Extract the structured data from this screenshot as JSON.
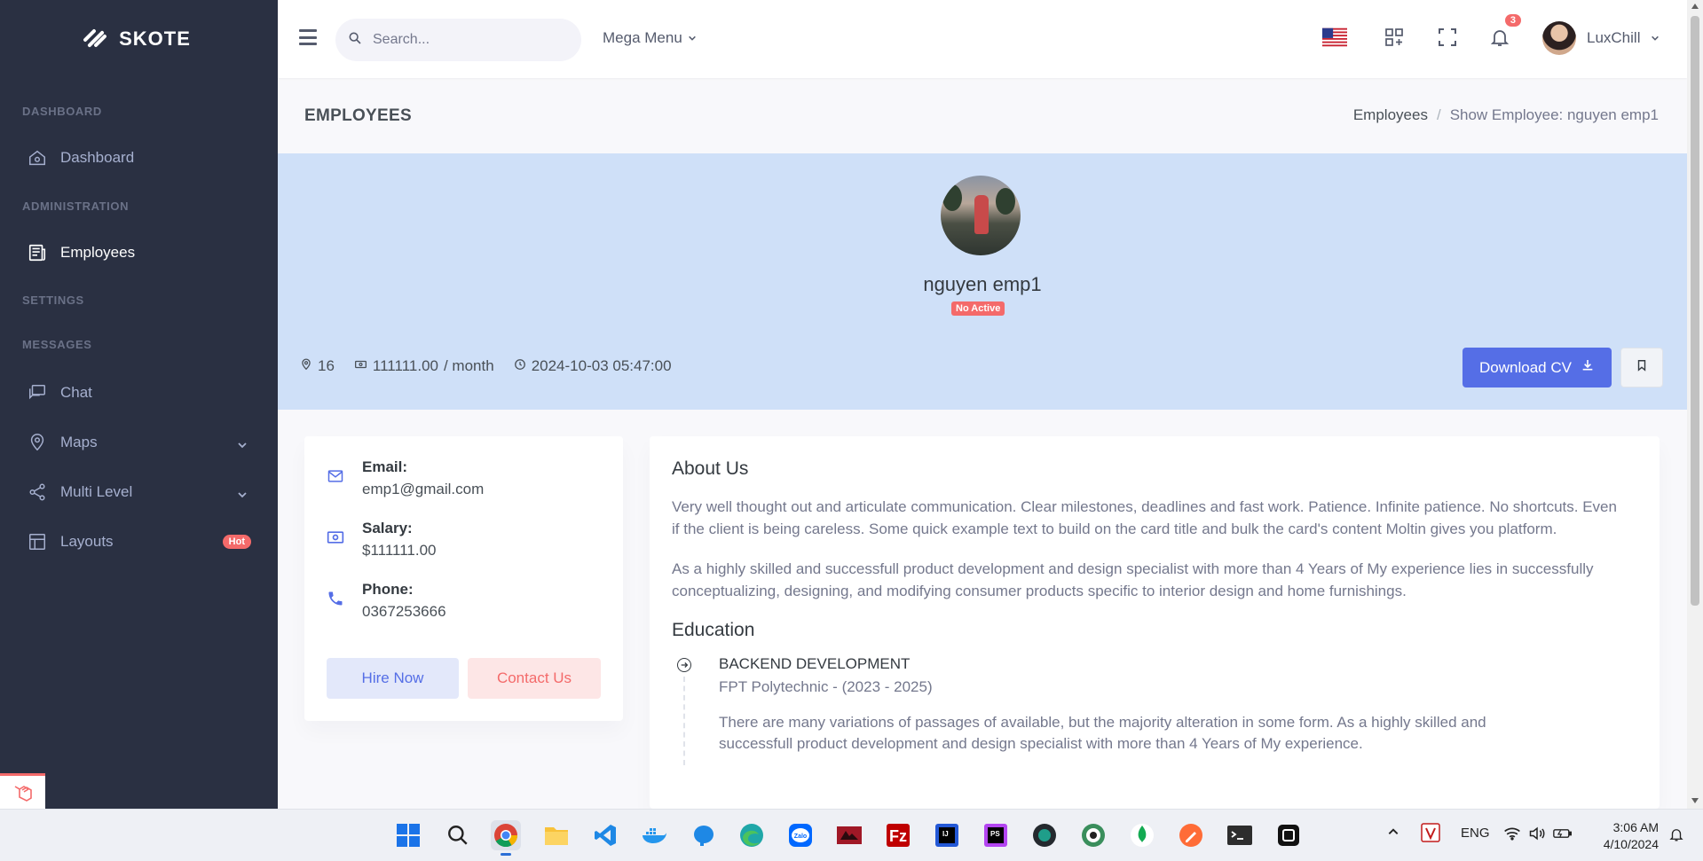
{
  "brand": {
    "name": "SKOTE"
  },
  "sidebar": {
    "sections": [
      {
        "title": "DASHBOARD"
      },
      {
        "title": "ADMINISTRATION"
      },
      {
        "title": "SETTINGS"
      },
      {
        "title": "MESSAGES"
      }
    ],
    "items": [
      {
        "label": "Dashboard",
        "icon": "home-icon"
      },
      {
        "label": "Employees",
        "icon": "newspaper-icon",
        "active": true
      },
      {
        "label": "Chat",
        "icon": "chat-icon"
      },
      {
        "label": "Maps",
        "icon": "map-pin-icon"
      },
      {
        "label": "Multi Level",
        "icon": "share-icon"
      },
      {
        "label": "Layouts",
        "icon": "layout-icon",
        "badge": "Hot"
      }
    ]
  },
  "topbar": {
    "search_placeholder": "Search...",
    "mega_menu": "Mega Menu",
    "notification_count": "3",
    "user_name": "LuxChill"
  },
  "page": {
    "title": "EMPLOYEES",
    "breadcrumb": {
      "parent": "Employees",
      "separator": "/",
      "current": "Show Employee: nguyen emp1"
    }
  },
  "profile": {
    "name": "nguyen emp1",
    "status": "No Active",
    "location": "16",
    "salary_amount": "111111.00",
    "salary_unit": "/ month",
    "updated": "2024-10-03 05:47:00",
    "download_label": "Download CV"
  },
  "contact": {
    "email_label": "Email:",
    "email": "emp1@gmail.com",
    "salary_label": "Salary:",
    "salary": "$111111.00",
    "phone_label": "Phone:",
    "phone": "0367253666",
    "hire_label": "Hire Now",
    "contact_label": "Contact Us"
  },
  "about": {
    "title": "About Us",
    "p1": "Very well thought out and articulate communication. Clear milestones, deadlines and fast work. Patience. Infinite patience. No shortcuts. Even if the client is being careless. Some quick example text to build on the card title and bulk the card's content Moltin gives you platform.",
    "p2": "As a highly skilled and successfull product development and design specialist with more than 4 Years of My experience lies in successfully conceptualizing, designing, and modifying consumer products specific to interior design and home furnishings.",
    "education_title": "Education",
    "education": [
      {
        "title": "BACKEND DEVELOPMENT",
        "school": "FPT Polytechnic - (2023 - 2025)",
        "desc": "There are many variations of passages of available, but the majority alteration in some form. As a highly skilled and successfull product development and design specialist with more than 4 Years of My experience."
      }
    ]
  },
  "taskbar": {
    "lang": "ENG",
    "time": "3:06 AM",
    "date": "4/10/2024",
    "apps": [
      "windows-start-icon",
      "search-icon",
      "chrome-icon",
      "file-explorer-icon",
      "vscode-icon",
      "docker-icon",
      "elephant-icon",
      "edge-icon",
      "zalo-icon",
      "app-red-icon",
      "filezilla-icon",
      "intellij-icon",
      "phpstorm-icon",
      "github-desktop-icon",
      "app-globe-icon",
      "mongodb-icon",
      "postman-icon",
      "terminal-icon",
      "app-black-icon"
    ]
  },
  "colors": {
    "sidebar_bg": "#2a3042",
    "primary": "#556ee6",
    "danger": "#f46a6a",
    "hero_bg": "#cfe0f8"
  }
}
